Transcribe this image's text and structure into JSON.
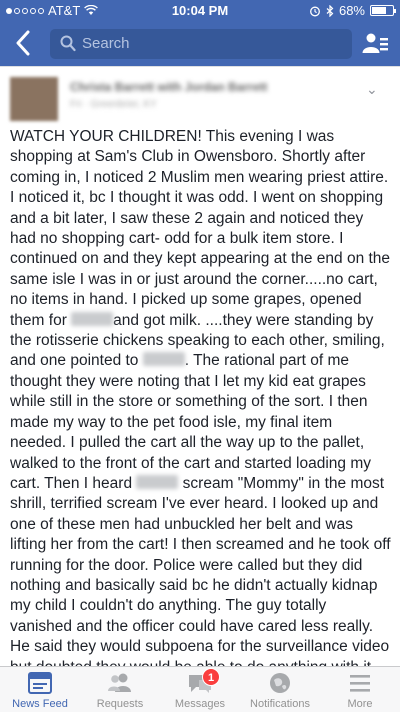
{
  "status_bar": {
    "carrier": "AT&T",
    "time": "10:04 PM",
    "battery": "68%",
    "battery_level": 0.68,
    "icons": [
      "wifi-icon",
      "alarm-icon",
      "bluetooth-icon",
      "battery-icon"
    ]
  },
  "nav": {
    "back_icon": "back-chevron-icon",
    "search_placeholder": "Search",
    "friends_icon": "friends-list-icon"
  },
  "post": {
    "author": "Christa Barrett with Jordan Barrett",
    "meta": "Fri · Greenbrier, KY",
    "segments": [
      "WATCH YOUR CHILDREN! This evening I was shopping at Sam's Club in Owensboro.  Shortly after coming in, I noticed 2 Muslim men wearing priest attire. I noticed it, bc I thought it was odd.   I went on shopping and a bit later, I saw these 2 again and noticed they had no shopping cart- odd for a bulk item store. I continued on and they kept appearing at the end on the same isle I was in or just around the corner.....no cart, no items in hand. I picked up some grapes, opened them for ",
      "and got milk. ....they were standing by the rotisserie chickens speaking to each other, smiling, and one pointed to ",
      ". The rational part of me thought they were noting that I let my kid eat grapes while still in the store or something of the sort. I then made my way to the pet food isle, my final item needed.  I pulled the cart all the way up to the pallet, walked to the front of the cart and started loading my cart. Then I heard ",
      " scream \"Mommy\" in the most shrill, terrified scream I've ever heard. I looked up and one of these men had unbuckled her belt and was lifting her from the cart! I then screamed and he took off running for the door.  Police were called but they did nothing and basically said bc he didn't actually kidnap my child I couldn't do anything.  The guy totally vanished and the officer could have cared less really. He said they would subpoena for the surveillance video but doubted they would be able to do anything with it.  Watch your"
    ]
  },
  "tabs": [
    {
      "label": "News Feed",
      "icon": "news-feed-icon",
      "active": true
    },
    {
      "label": "Requests",
      "icon": "requests-icon",
      "active": false
    },
    {
      "label": "Messages",
      "icon": "messages-icon",
      "active": false,
      "badge": "1"
    },
    {
      "label": "Notifications",
      "icon": "notifications-icon",
      "active": false
    },
    {
      "label": "More",
      "icon": "more-icon",
      "active": false
    }
  ],
  "colors": {
    "brand_blue": "#4267b2",
    "badge_red": "#fa3e3e"
  }
}
